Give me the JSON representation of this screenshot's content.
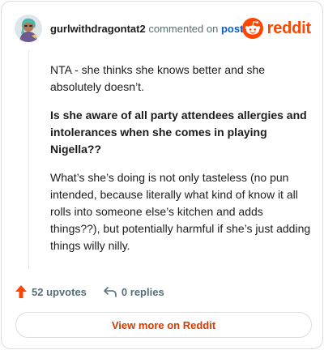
{
  "header": {
    "username": "gurlwithdragontat2",
    "commented_on": "commented on",
    "post_link": "post",
    "brand": "reddit"
  },
  "comment": {
    "paragraphs": [
      "NTA - she thinks she knows better and she absolutely doesn’t.",
      "Is she aware of all party attendees allergies and intolerances when she comes in playing Nigella??",
      "What’s she’s doing is not only tasteless (no pun intended, because literally what kind of know it all rolls into someone else’s kitchen and adds things??), but potentially harmful if she’s just adding things willy nilly."
    ]
  },
  "actions": {
    "upvotes": "52 upvotes",
    "replies": "0 replies"
  },
  "footer": {
    "view_more": "View more on Reddit"
  },
  "colors": {
    "accent": "#ff4500",
    "link": "#0a5cc2",
    "button_text": "#d93a00"
  }
}
